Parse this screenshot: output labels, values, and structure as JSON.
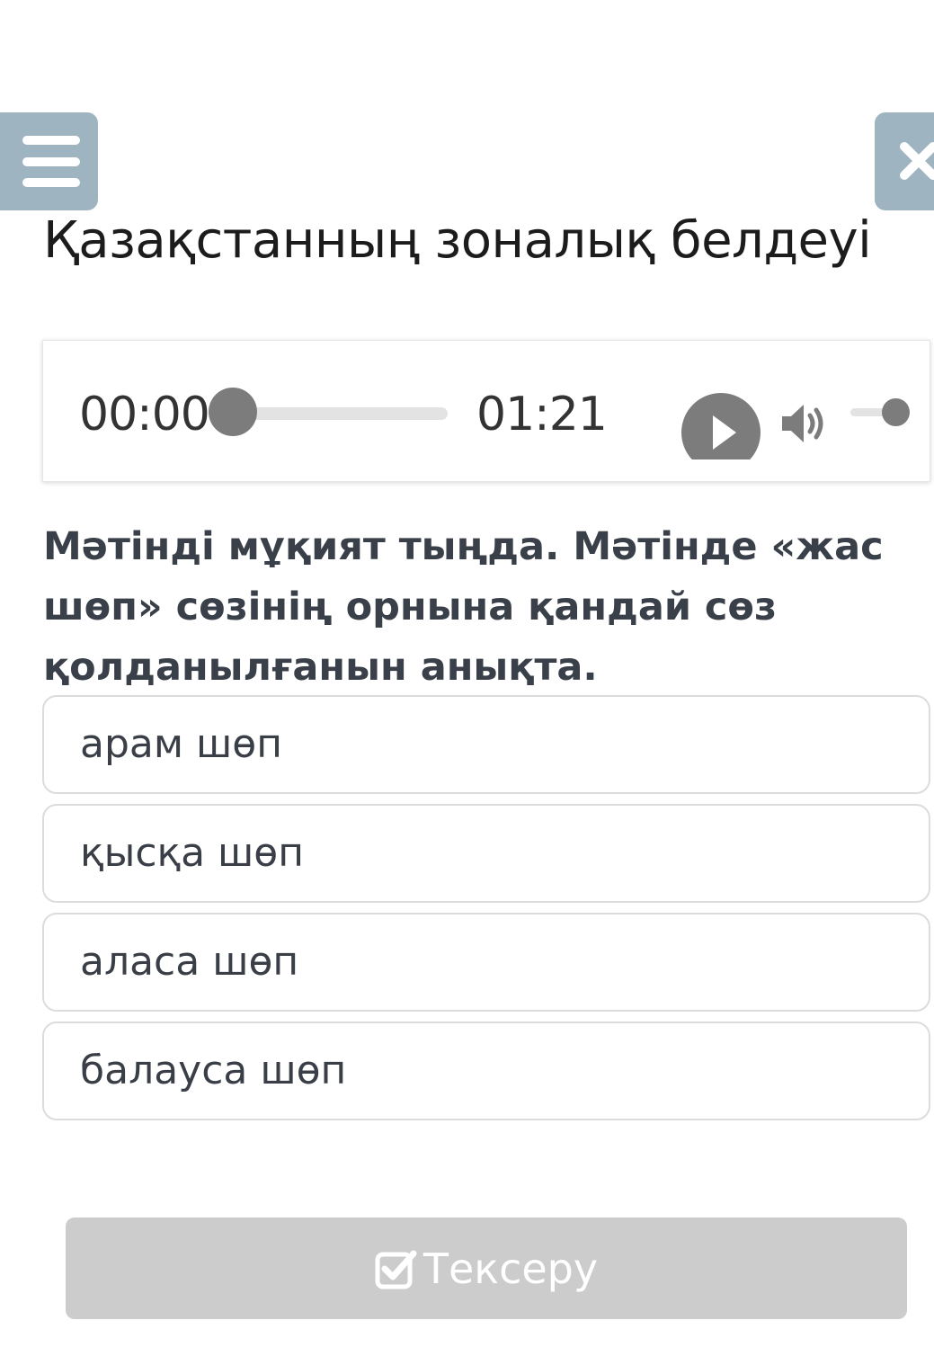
{
  "header": {
    "menu_icon": "hamburger-menu-icon",
    "close_icon": "close-icon"
  },
  "page": {
    "title": "Қазақстанның зоналық белдеуі"
  },
  "audio": {
    "current_time": "00:00",
    "total_time": "01:21",
    "progress": 0,
    "volume": 1,
    "play_icon": "play-icon",
    "volume_icon": "volume-icon"
  },
  "question": {
    "text": "Мәтінді мұқият тыңда. Мәтінде «жас шөп» сөзінің орнына қандай сөз қолданылғанын анықта."
  },
  "options": [
    {
      "label": "арам шөп"
    },
    {
      "label": "қысқа шөп"
    },
    {
      "label": "аласа шөп"
    },
    {
      "label": "балауса шөп"
    }
  ],
  "check_button": {
    "label": "Тексеру",
    "icon": "checkbox-check-icon"
  },
  "colors": {
    "header_button_bg": "#9fb4c1",
    "player_control": "#7c7c7c",
    "check_button_disabled": "#cccccc",
    "question_text": "#3a4049"
  }
}
